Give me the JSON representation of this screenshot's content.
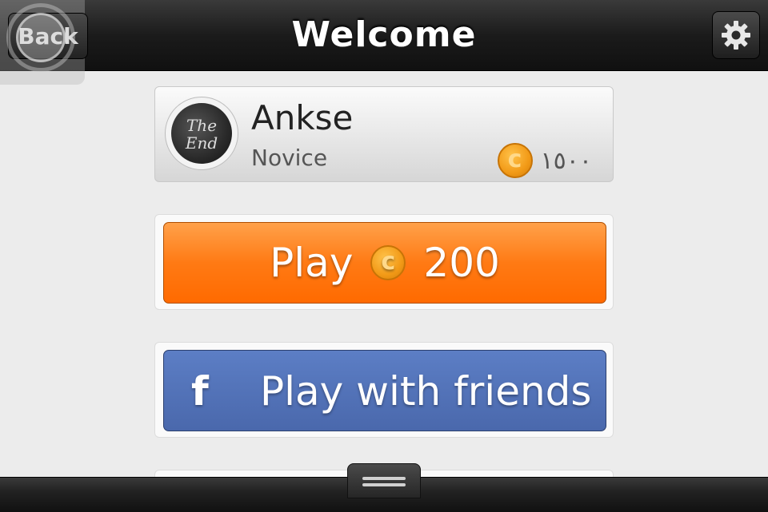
{
  "header": {
    "title": "Welcome",
    "back_label": "Back",
    "settings_icon": "gear-icon"
  },
  "profile": {
    "avatar_text": "The End",
    "username": "Ankse",
    "rank": "Novice",
    "balance": "١٥٠٠",
    "coin_icon": "coin-icon"
  },
  "actions": {
    "play_label": "Play",
    "play_cost": "200",
    "friends_label": "Play with friends",
    "facebook_icon": "f"
  },
  "footer": {
    "menu_icon": "menu-handle-icon"
  },
  "colors": {
    "play_orange": "#ff7a14",
    "facebook_blue": "#4a68ac",
    "coin_gold": "#f29a17"
  }
}
